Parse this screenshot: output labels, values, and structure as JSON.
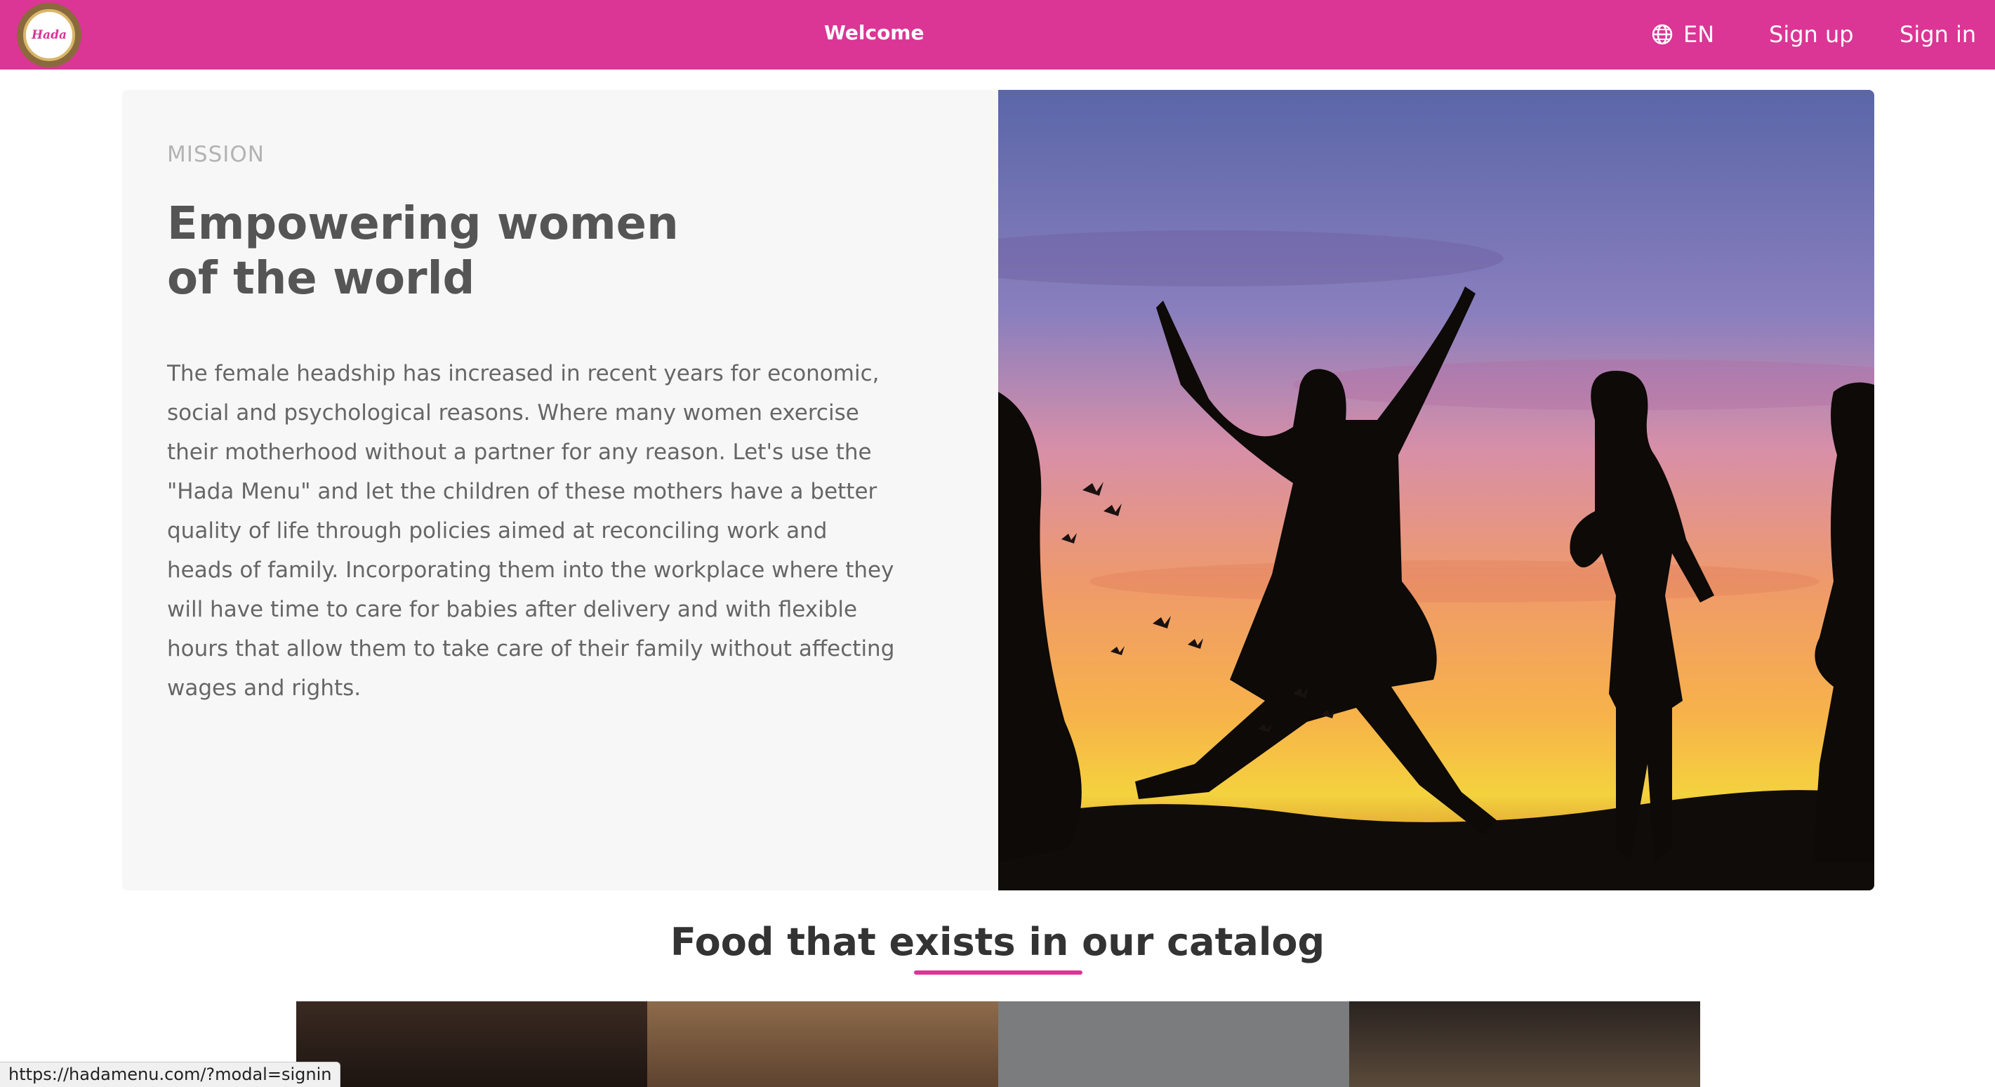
{
  "nav": {
    "logo_text": "Hada",
    "title": "Welcome",
    "language": "EN",
    "sign_up": "Sign up",
    "sign_in": "Sign in"
  },
  "mission": {
    "eyebrow": "MISSION",
    "heading": "Empowering women of the world",
    "body": "The female headship has increased in recent years for economic, social and psychological reasons. Where many women exercise their motherhood without a partner for any reason. Let's use the \"Hada Menu\" and let the children of these mothers have a better quality of life through policies aimed at reconciling work and heads of family. Incorporating them into the workplace where they will have time to care for babies after delivery and with flexible hours that allow them to take care of their family without affecting wages and rights."
  },
  "catalog": {
    "title": "Food that exists in our catalog"
  },
  "status_bar": {
    "url": "https://hadamenu.com/?modal=signin"
  },
  "colors": {
    "brand": "#db3595",
    "text": "#555555"
  }
}
